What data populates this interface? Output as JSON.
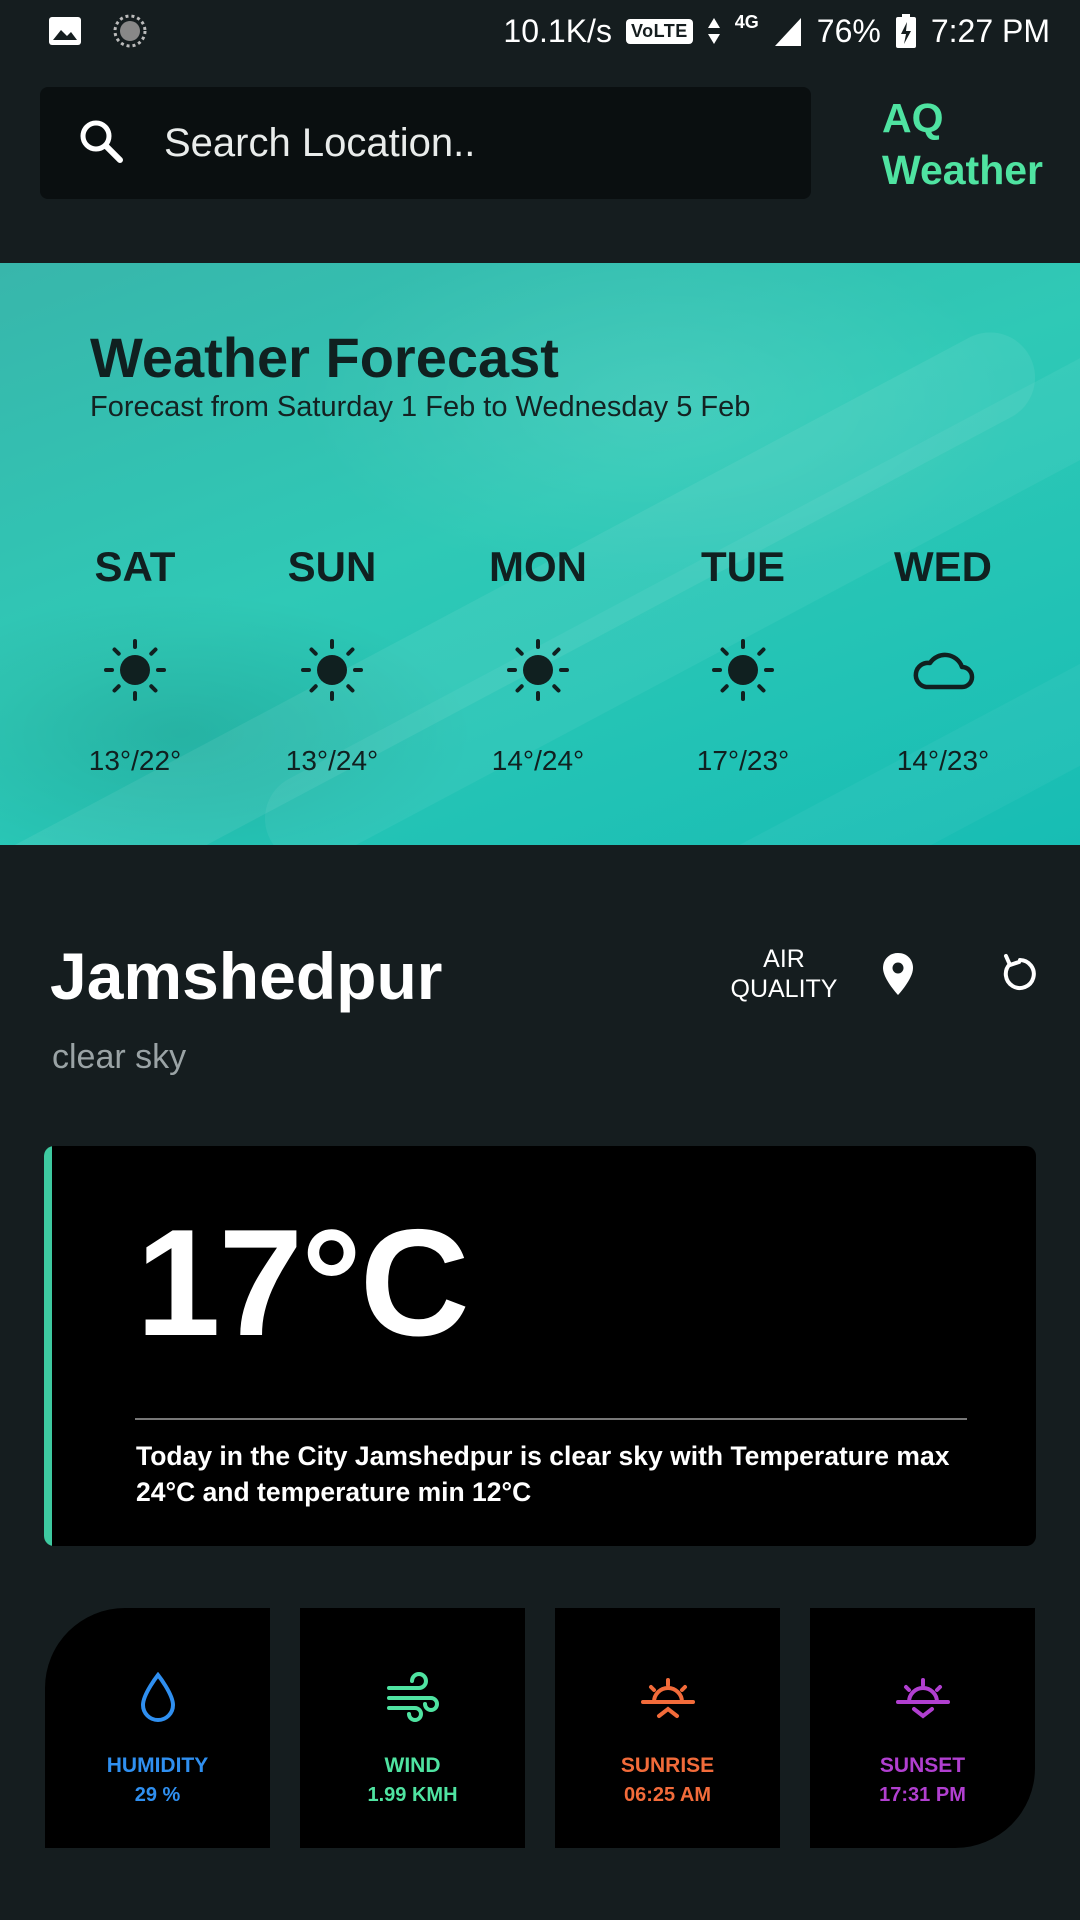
{
  "status_bar": {
    "speed": "10.1K/s",
    "volte": "VoLTE",
    "network": "4G",
    "battery": "76%",
    "time": "7:27 PM"
  },
  "search": {
    "placeholder": "Search Location.."
  },
  "brand": {
    "line1": "AQ",
    "line2": "Weather"
  },
  "forecast": {
    "title": "Weather Forecast",
    "subtitle": "Forecast from Saturday 1 Feb to Wednesday 5 Feb",
    "days": [
      {
        "day": "SAT",
        "icon": "sun-icon",
        "temps": "13°/22°"
      },
      {
        "day": "SUN",
        "icon": "sun-icon",
        "temps": "13°/24°"
      },
      {
        "day": "MON",
        "icon": "sun-icon",
        "temps": "14°/24°"
      },
      {
        "day": "TUE",
        "icon": "sun-icon",
        "temps": "17°/23°"
      },
      {
        "day": "WED",
        "icon": "cloud-icon",
        "temps": "14°/23°"
      }
    ]
  },
  "city": {
    "name": "Jamshedpur",
    "description": "clear sky",
    "air_quality_line1": "AIR",
    "air_quality_line2": "QUALITY"
  },
  "current": {
    "temperature": "17°C",
    "summary": "Today in the City Jamshedpur is clear sky with Temperature max 24°C and temperature min 12°C"
  },
  "metrics": [
    {
      "label": "HUMIDITY",
      "value": "29 %",
      "icon": "droplet-icon",
      "color": "#2f8ff0"
    },
    {
      "label": "WIND",
      "value": "1.99 KMH",
      "icon": "wind-icon",
      "color": "#4fe3a1"
    },
    {
      "label": "SUNRISE",
      "value": "06:25 AM",
      "icon": "sunrise-icon",
      "color": "#f26b3a"
    },
    {
      "label": "SUNSET",
      "value": "17:31 PM",
      "icon": "sunset-icon",
      "color": "#b13fd0"
    }
  ],
  "colors": {
    "background": "#151d1f",
    "brand": "#4fe3a1",
    "accent": "#3ec9a0",
    "forecast_banner": "#2fc9b6"
  }
}
